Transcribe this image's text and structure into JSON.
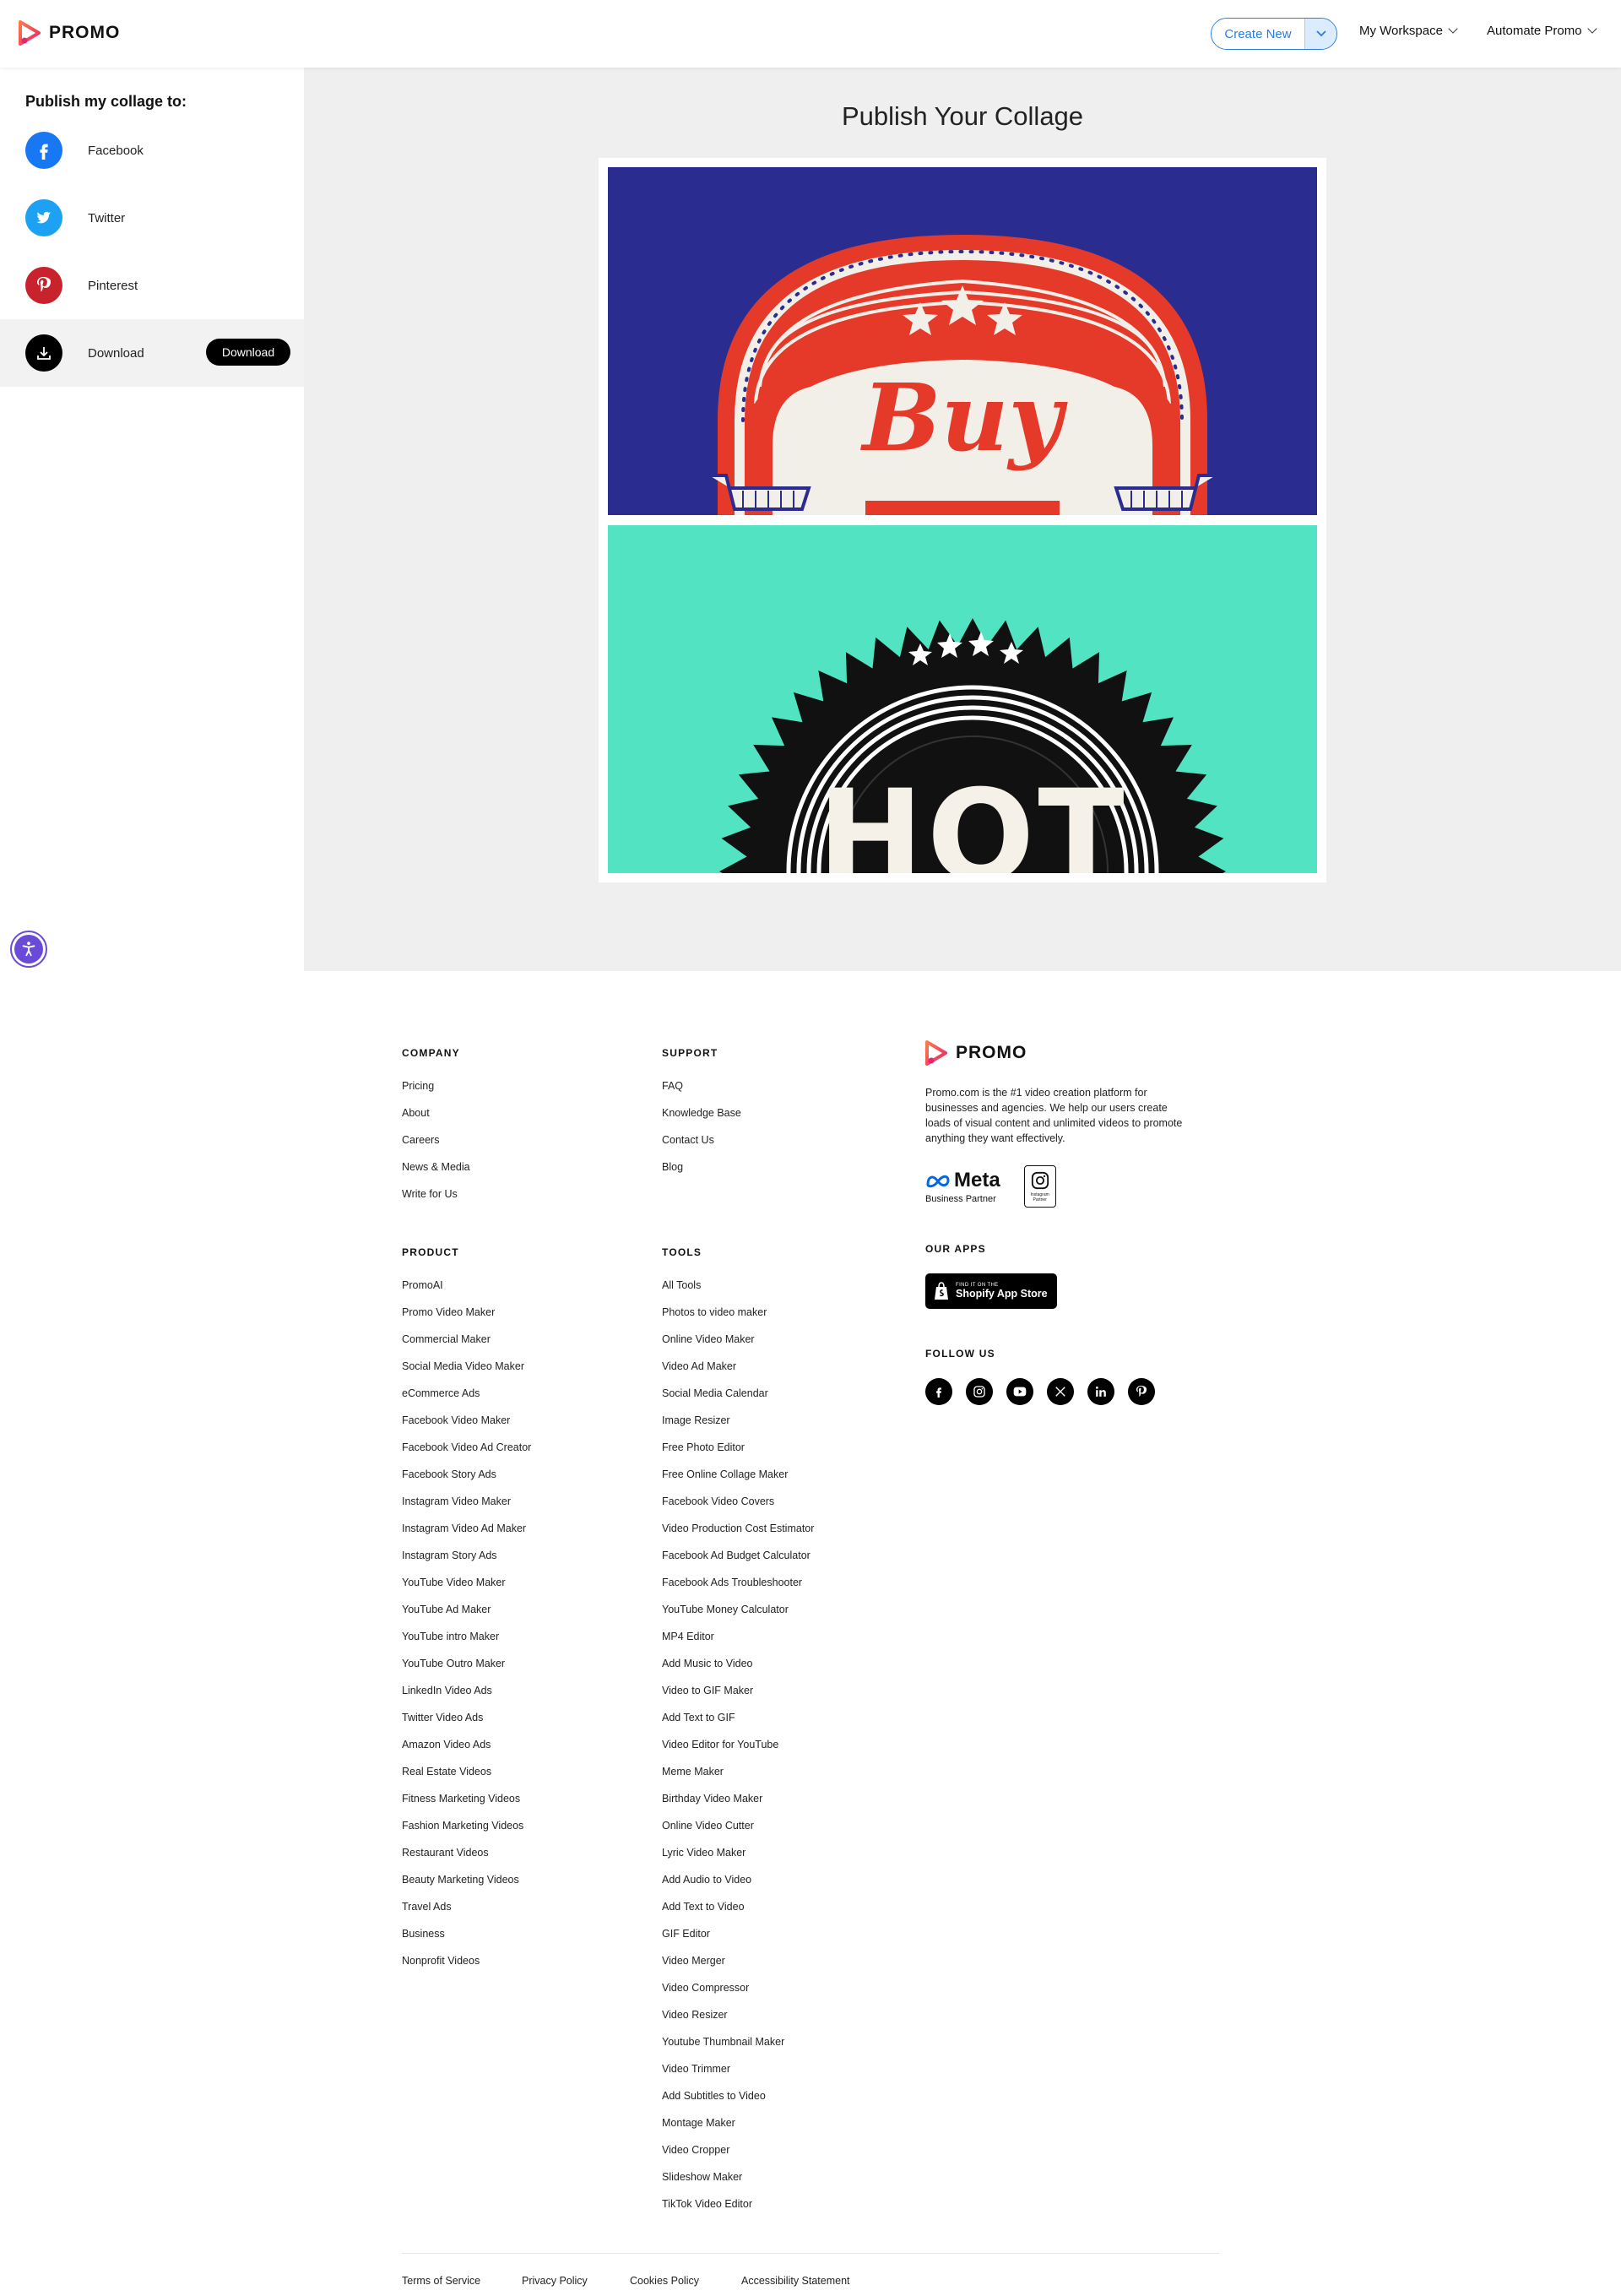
{
  "header": {
    "logo_text": "PROMO",
    "create_new": "Create New",
    "nav": [
      "My Workspace",
      "Automate Promo"
    ]
  },
  "sidebar": {
    "title": "Publish my collage to:",
    "items": [
      {
        "label": "Facebook",
        "icon": "facebook-icon",
        "color": "#1877f2"
      },
      {
        "label": "Twitter",
        "icon": "twitter-icon",
        "color": "#1da1f2"
      },
      {
        "label": "Pinterest",
        "icon": "pinterest-icon",
        "color": "#c8232c"
      },
      {
        "label": "Download",
        "icon": "download-icon",
        "color": "#000000"
      }
    ],
    "download_button": "Download"
  },
  "main": {
    "title": "Publish Your Collage",
    "collage": {
      "top_text": "Buy",
      "bottom_text": "HOT"
    }
  },
  "footer": {
    "company": {
      "heading": "Company",
      "links": [
        "Pricing",
        "About",
        "Careers",
        "News & Media",
        "Write for Us"
      ]
    },
    "support": {
      "heading": "Support",
      "links": [
        "FAQ",
        "Knowledge Base",
        "Contact Us",
        "Blog"
      ]
    },
    "product": {
      "heading": "Product",
      "links": [
        "PromoAI",
        "Promo Video Maker",
        "Commercial Maker",
        "Social Media Video Maker",
        "eCommerce Ads",
        "Facebook Video Maker",
        "Facebook Video Ad Creator",
        "Facebook Story Ads",
        "Instagram Video Maker",
        "Instagram Video Ad Maker",
        "Instagram Story Ads",
        "YouTube Video Maker",
        "YouTube Ad Maker",
        "YouTube intro Maker",
        "YouTube Outro Maker",
        "LinkedIn Video Ads",
        "Twitter Video Ads",
        "Amazon Video Ads",
        "Real Estate Videos",
        "Fitness Marketing Videos",
        "Fashion Marketing Videos",
        "Restaurant Videos",
        "Beauty Marketing Videos",
        "Travel Ads",
        "Business",
        "Nonprofit Videos"
      ]
    },
    "tools": {
      "heading": "Tools",
      "links": [
        "All Tools",
        "Photos to video maker",
        "Online Video Maker",
        "Video Ad Maker",
        "Social Media Calendar",
        "Image Resizer",
        "Free Photo Editor",
        "Free Online Collage Maker",
        "Facebook Video Covers",
        "Video Production Cost Estimator",
        "Facebook Ad Budget Calculator",
        "Facebook Ads Troubleshooter",
        "YouTube Money Calculator",
        "MP4 Editor",
        "Add Music to Video",
        "Video to GIF Maker",
        "Add Text to GIF",
        "Video Editor for YouTube",
        "Meme Maker",
        "Birthday Video Maker",
        "Online Video Cutter",
        "Lyric Video Maker",
        "Add Audio to Video",
        "Add Text to Video",
        "GIF Editor",
        "Video Merger",
        "Video Compressor",
        "Video Resizer",
        "Youtube Thumbnail Maker",
        "Video Trimmer",
        "Add Subtitles to Video",
        "Montage Maker",
        "Video Cropper",
        "Slideshow Maker",
        "TikTok Video Editor"
      ]
    },
    "brand": {
      "logo_text": "PROMO",
      "description": "Promo.com is the #1 video creation platform for businesses and agencies.  We help our users create loads of visual content and unlimited videos to promote anything they want effectively.",
      "meta_word": "Meta",
      "meta_sub": "Business Partner",
      "ig_partner": "Instagram Partner"
    },
    "apps": {
      "heading": "Our Apps",
      "shopify_top": "FIND IT ON THE",
      "shopify_bottom": "Shopify App Store"
    },
    "follow": {
      "heading": "Follow Us",
      "icons": [
        "facebook-icon",
        "instagram-icon",
        "youtube-icon",
        "x-icon",
        "linkedin-icon",
        "pinterest-icon"
      ]
    },
    "legal": [
      "Terms of Service",
      "Privacy Policy",
      "Cookies Policy",
      "Accessibility Statement"
    ]
  }
}
